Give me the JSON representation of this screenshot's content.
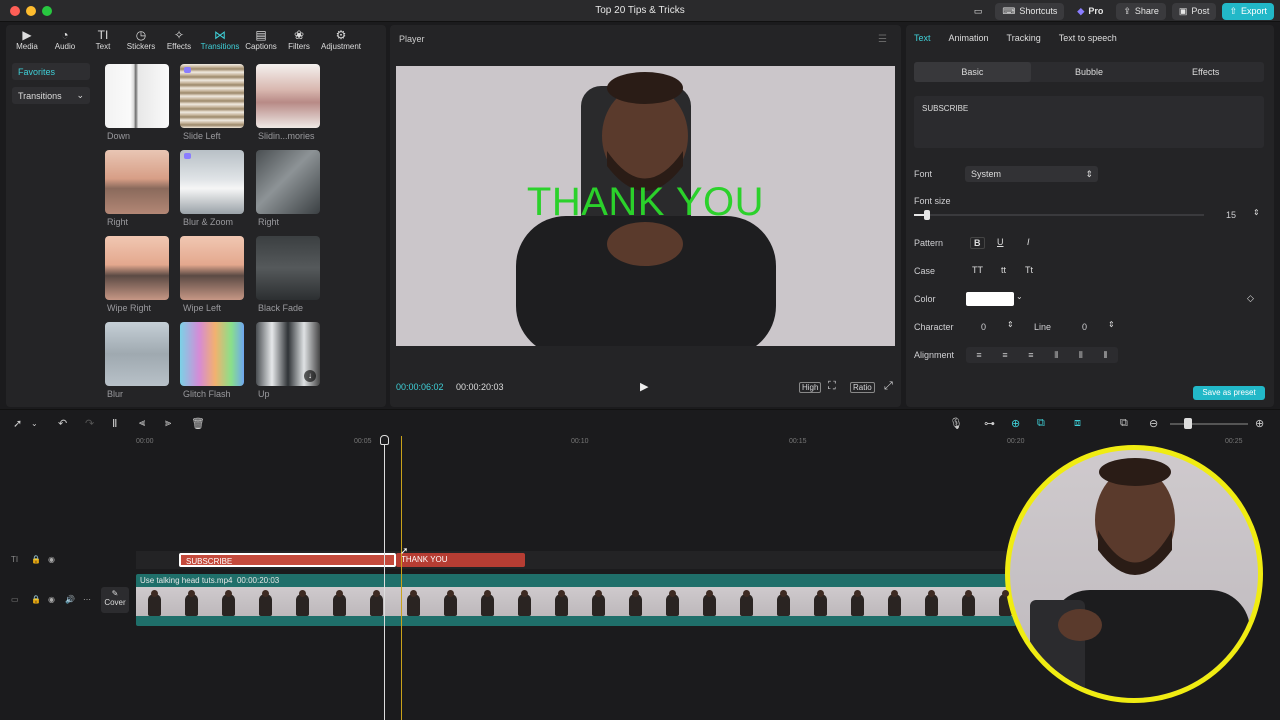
{
  "window": {
    "title": "Top 20 Tips & Tricks"
  },
  "topbar": {
    "shortcuts": "Shortcuts",
    "pro": "Pro",
    "share": "Share",
    "post": "Post",
    "export": "Export"
  },
  "media_tabs": [
    {
      "label": "Media",
      "icon": "media-icon"
    },
    {
      "label": "Audio",
      "icon": "audio-icon"
    },
    {
      "label": "Text",
      "icon": "text-icon"
    },
    {
      "label": "Stickers",
      "icon": "stickers-icon"
    },
    {
      "label": "Effects",
      "icon": "effects-icon"
    },
    {
      "label": "Transitions",
      "icon": "transitions-icon"
    },
    {
      "label": "Captions",
      "icon": "captions-icon"
    },
    {
      "label": "Filters",
      "icon": "filters-icon"
    },
    {
      "label": "Adjustment",
      "icon": "adjustment-icon"
    }
  ],
  "sidebar": {
    "favorites": "Favorites",
    "transitions": "Transitions"
  },
  "transitions": [
    {
      "label": "Down"
    },
    {
      "label": "Slide Left"
    },
    {
      "label": "Slidin...mories"
    },
    {
      "label": "Right"
    },
    {
      "label": "Blur & Zoom"
    },
    {
      "label": "Right"
    },
    {
      "label": "Wipe Right"
    },
    {
      "label": "Wipe Left"
    },
    {
      "label": "Black Fade"
    },
    {
      "label": "Blur"
    },
    {
      "label": "Glitch Flash"
    },
    {
      "label": "Up"
    }
  ],
  "player": {
    "title": "Player",
    "overlay_text": "THANK YOU",
    "current_time": "00:00:06:02",
    "total_time": "00:00:20:03",
    "quality": "High",
    "ratio": "Ratio"
  },
  "inspector": {
    "tabs": [
      "Text",
      "Animation",
      "Tracking",
      "Text to speech"
    ],
    "subtabs": [
      "Basic",
      "Bubble",
      "Effects"
    ],
    "text_value": "SUBSCRIBE",
    "font_label": "Font",
    "font_value": "System",
    "font_size_label": "Font size",
    "font_size_value": "15",
    "pattern_label": "Pattern",
    "case_label": "Case",
    "case_options": [
      "TT",
      "tt",
      "Tt"
    ],
    "color_label": "Color",
    "character_label": "Character",
    "character_value": "0",
    "line_label": "Line",
    "line_value": "0",
    "alignment_label": "Alignment",
    "save_preset": "Save as preset"
  },
  "timeline": {
    "ruler": [
      "00:00",
      "00:05",
      "00:10",
      "00:15",
      "00:20",
      "00:25"
    ],
    "text_clip_1": "SUBSCRIBE",
    "text_clip_2": "THANK YOU",
    "video_clip_name": "Use talking head tuts.mp4",
    "video_clip_duration": "00:00:20:03",
    "cover_label": "Cover"
  }
}
